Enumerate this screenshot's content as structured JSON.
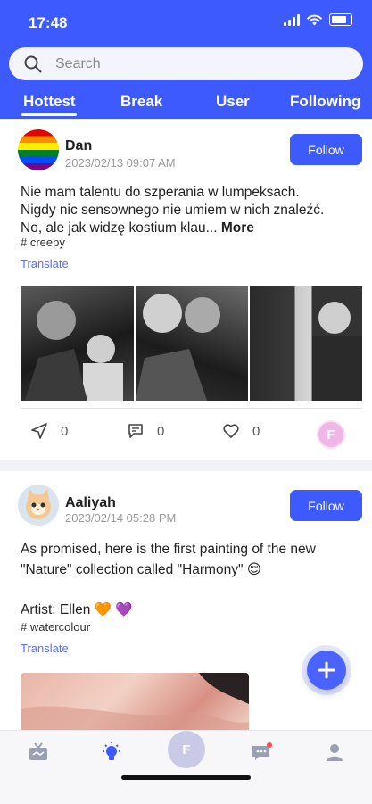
{
  "status": {
    "time": "17:48"
  },
  "search": {
    "placeholder": "Search"
  },
  "tabs": [
    {
      "label": "Hottest",
      "active": true
    },
    {
      "label": "Break"
    },
    {
      "label": "User"
    },
    {
      "label": "Following"
    }
  ],
  "posts": [
    {
      "user": "Dan",
      "date": "2023/02/13 09:07 AM",
      "follow_label": "Follow",
      "text_lines": [
        "Nie mam talentu do szperania w lumpeksach.",
        "Nigdy nic sensownego nie umiem w nich znaleźć.",
        "No, ale jak widzę kostium klau..."
      ],
      "more_label": "More",
      "tag": "# creepy",
      "translate_label": "Translate",
      "shares": "0",
      "comments": "0",
      "likes": "0",
      "liker_initial": "F"
    },
    {
      "user": "Aaliyah",
      "date": "2023/02/14 05:28 PM",
      "follow_label": "Follow",
      "text_line1": "As promised, here is the first painting of the new",
      "text_line2": "\"Nature\" collection called \"Harmony\" 😌",
      "artist_line": "Artist: Ellen 🧡 💜",
      "tag": "# watercolour",
      "translate_label": "Translate"
    }
  ],
  "bottom_nav": {
    "center_initial": "F"
  },
  "colors": {
    "primary": "#3d5afe",
    "link": "#5a6cff"
  }
}
